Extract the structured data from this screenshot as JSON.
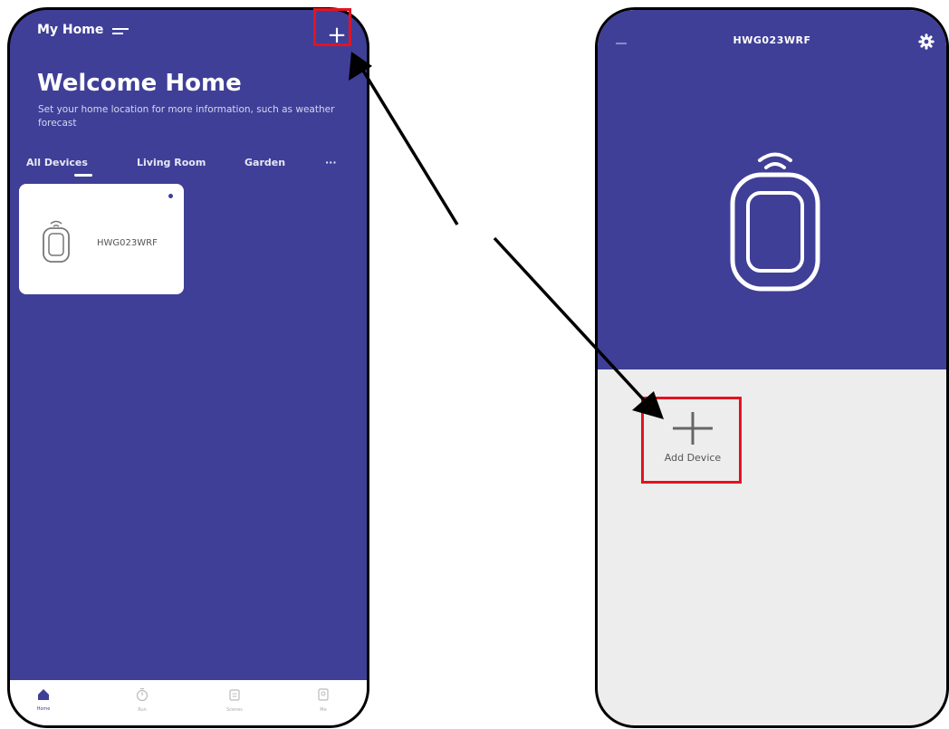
{
  "left_screen": {
    "home_title": "My Home",
    "welcome_title": "Welcome Home",
    "subtitle": "Set your home location for more information, such as weather forecast",
    "tabs": [
      {
        "label": "All Devices",
        "active": true
      },
      {
        "label": "Living Room",
        "active": false
      },
      {
        "label": "Garden",
        "active": false
      },
      {
        "label": "···",
        "active": false
      }
    ],
    "add_icon": "plus-icon",
    "device": {
      "name": "HWG023WRF",
      "icon": "remote-icon"
    },
    "bottom_nav": [
      {
        "label": "Home",
        "icon": "home-icon",
        "active": true
      },
      {
        "label": "Run",
        "icon": "timer-icon",
        "active": false
      },
      {
        "label": "Scenes",
        "icon": "scene-icon",
        "active": false
      },
      {
        "label": "Me",
        "icon": "profile-icon",
        "active": false
      }
    ]
  },
  "right_screen": {
    "title": "HWG023WRF",
    "settings_icon": "gear-icon",
    "device_icon": "remote-icon",
    "add_device_label": "Add Device",
    "add_device_icon": "plus-icon"
  },
  "colors": {
    "primary": "#3f3f98",
    "highlight": "#e3131f",
    "background": "#ededed"
  }
}
